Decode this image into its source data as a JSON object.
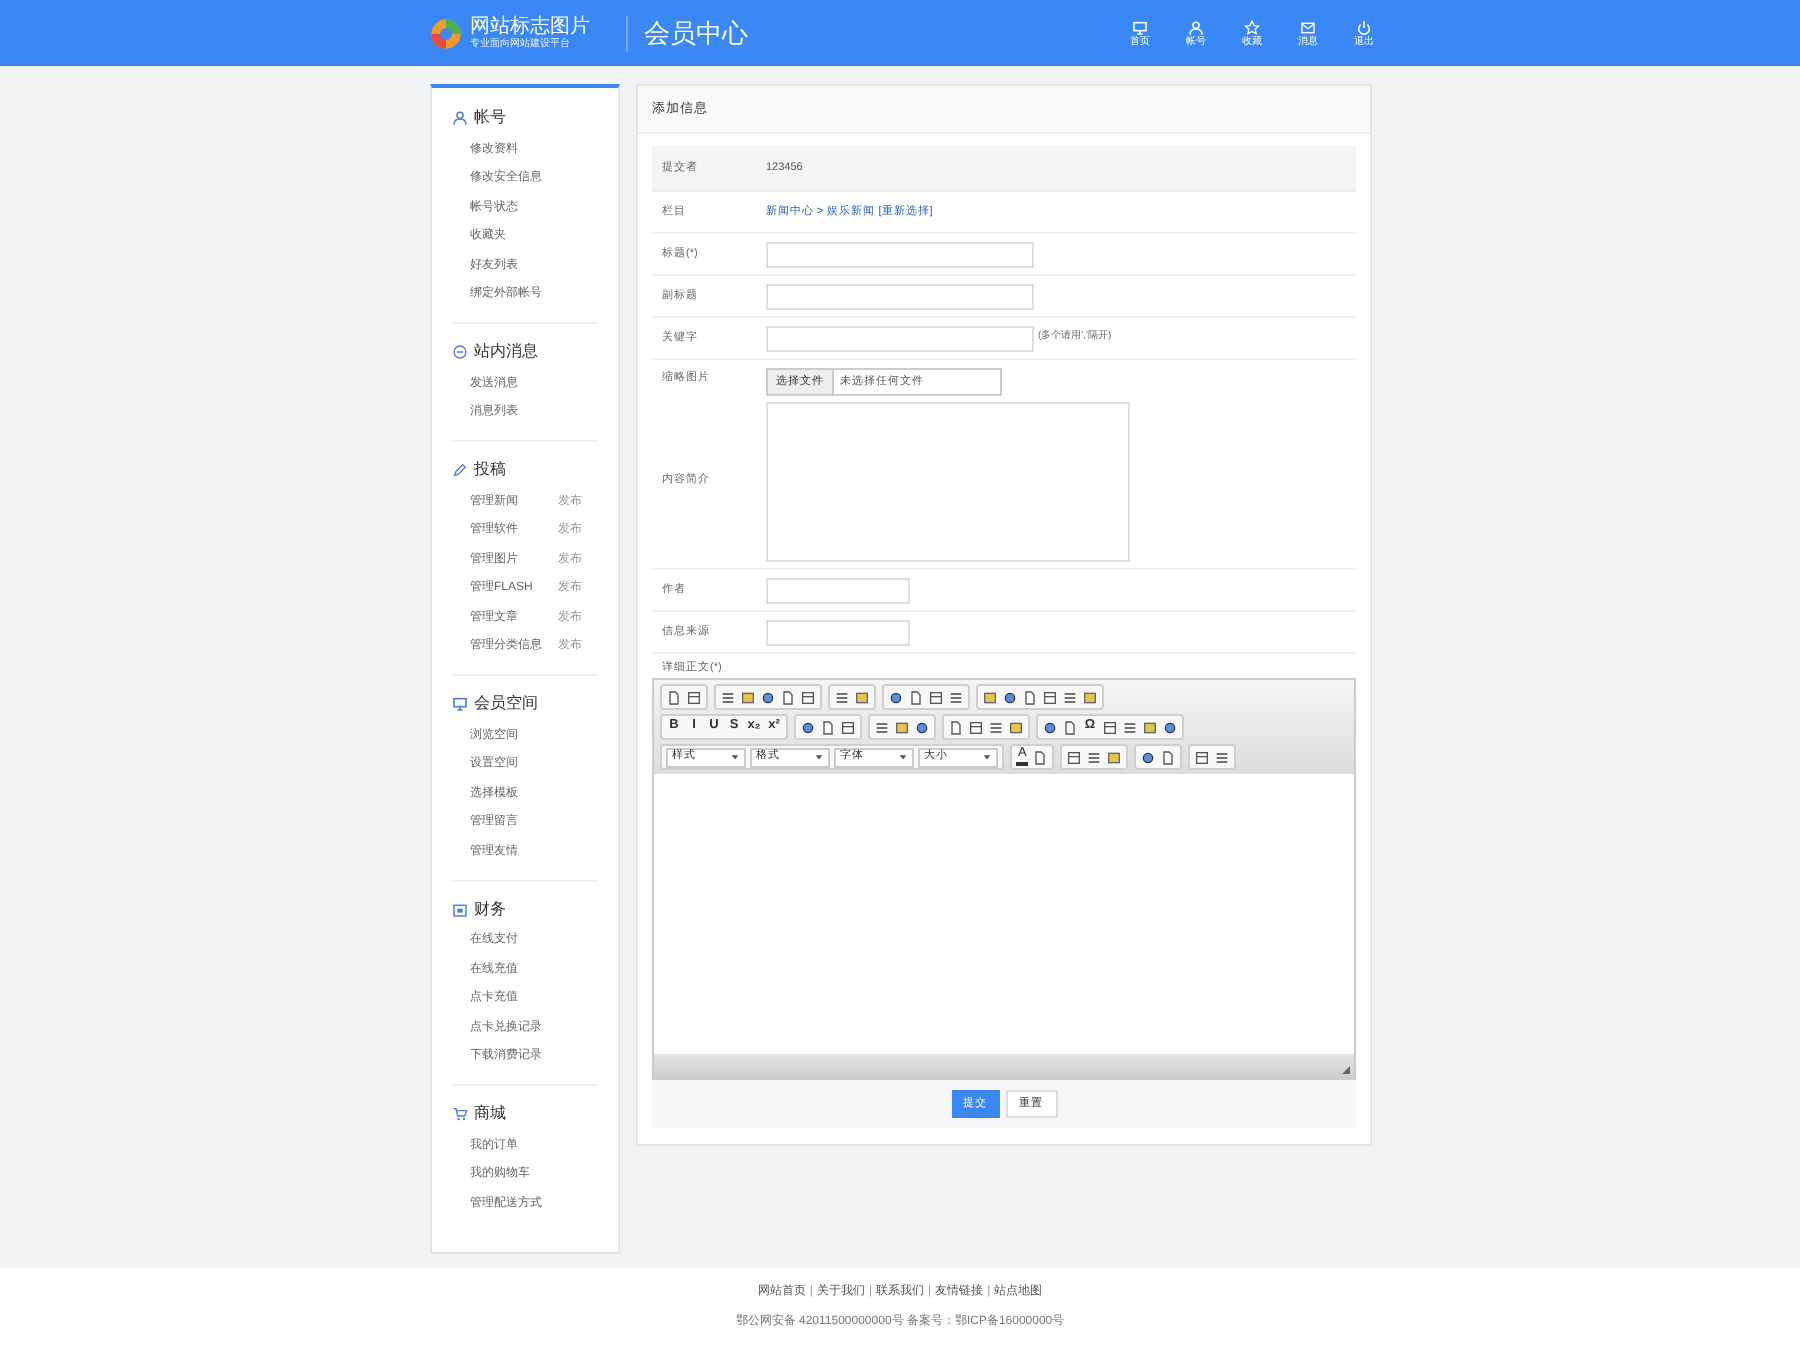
{
  "header": {
    "logo_text": "网站标志图片",
    "logo_subtitle": "专业面向网站建设平台",
    "title": "会员中心",
    "nav": [
      {
        "label": "首页"
      },
      {
        "label": "帐号"
      },
      {
        "label": "收藏"
      },
      {
        "label": "消息"
      },
      {
        "label": "退出"
      }
    ]
  },
  "sidebar": [
    {
      "title": "帐号",
      "items": [
        {
          "label": "修改资料"
        },
        {
          "label": "修改安全信息"
        },
        {
          "label": "帐号状态"
        },
        {
          "label": "收藏夹"
        },
        {
          "label": "好友列表"
        },
        {
          "label": "绑定外部帐号"
        }
      ]
    },
    {
      "title": "站内消息",
      "items": [
        {
          "label": "发送消息"
        },
        {
          "label": "消息列表"
        }
      ]
    },
    {
      "title": "投稿",
      "items": [
        {
          "label": "管理新闻",
          "action": "发布"
        },
        {
          "label": "管理软件",
          "action": "发布"
        },
        {
          "label": "管理图片",
          "action": "发布"
        },
        {
          "label": "管理FLASH",
          "action": "发布"
        },
        {
          "label": "管理文章",
          "action": "发布"
        },
        {
          "label": "管理分类信息",
          "action": "发布"
        }
      ]
    },
    {
      "title": "会员空间",
      "items": [
        {
          "label": "浏览空间"
        },
        {
          "label": "设置空间"
        },
        {
          "label": "选择模板"
        },
        {
          "label": "管理留言"
        },
        {
          "label": "管理友情"
        }
      ]
    },
    {
      "title": "财务",
      "items": [
        {
          "label": "在线支付"
        },
        {
          "label": "在线充值"
        },
        {
          "label": "点卡充值"
        },
        {
          "label": "点卡兑换记录"
        },
        {
          "label": "下载消费记录"
        }
      ]
    },
    {
      "title": "商城",
      "items": [
        {
          "label": "我的订单"
        },
        {
          "label": "我的购物车"
        },
        {
          "label": "管理配送方式"
        }
      ]
    }
  ],
  "panel": {
    "title": "添加信息",
    "rows": [
      {
        "kind": "text",
        "label": "提交者",
        "value": "123456"
      },
      {
        "kind": "path",
        "label": "栏目",
        "value": "新闻中心 > 娱乐新闻",
        "link": "[重新选择]"
      },
      {
        "kind": "input",
        "label": "标题(*)"
      },
      {
        "kind": "input",
        "label": "副标题"
      },
      {
        "kind": "input",
        "label": "关键字",
        "hint": "(多个请用','隔开)"
      },
      {
        "kind": "file",
        "label": "缩略图片",
        "button": "选择文件",
        "value": "未选择任何文件"
      },
      {
        "kind": "textarea",
        "label": "内容简介"
      },
      {
        "kind": "short",
        "label": "作者"
      },
      {
        "kind": "short",
        "label": "信息来源"
      }
    ],
    "editor": {
      "label": "详细正文(*)",
      "rows": [
        [
          [
            {
              "kind": "icon"
            },
            {
              "kind": "icon"
            }
          ],
          [
            {
              "kind": "icon"
            },
            {
              "kind": "icon"
            },
            {
              "kind": "icon"
            },
            {
              "kind": "icon"
            },
            {
              "kind": "icon"
            }
          ],
          [
            {
              "kind": "icon"
            },
            {
              "kind": "icon"
            }
          ],
          [
            {
              "kind": "icon"
            },
            {
              "kind": "icon"
            },
            {
              "kind": "icon"
            },
            {
              "kind": "icon"
            }
          ],
          [
            {
              "kind": "icon"
            },
            {
              "kind": "icon"
            },
            {
              "kind": "icon"
            },
            {
              "kind": "icon"
            },
            {
              "kind": "icon"
            },
            {
              "kind": "icon"
            }
          ]
        ],
        [
          [
            {
              "kind": "glyph",
              "text": "B"
            },
            {
              "kind": "glyph",
              "text": "I"
            },
            {
              "kind": "glyph",
              "text": "U"
            },
            {
              "kind": "glyph",
              "text": "S"
            },
            {
              "kind": "glyph",
              "text": "x₂"
            },
            {
              "kind": "glyph",
              "text": "x²"
            }
          ],
          [
            {
              "kind": "icon"
            },
            {
              "kind": "icon"
            },
            {
              "kind": "icon"
            }
          ],
          [
            {
              "kind": "icon"
            },
            {
              "kind": "icon"
            },
            {
              "kind": "icon"
            }
          ],
          [
            {
              "kind": "icon"
            },
            {
              "kind": "icon"
            },
            {
              "kind": "icon"
            },
            {
              "kind": "icon"
            }
          ],
          [
            {
              "kind": "icon"
            },
            {
              "kind": "icon"
            },
            {
              "kind": "glyph",
              "text": "Ω"
            },
            {
              "kind": "icon"
            },
            {
              "kind": "icon"
            },
            {
              "kind": "icon"
            },
            {
              "kind": "icon"
            }
          ]
        ],
        [
          [
            {
              "kind": "select",
              "text": "样式"
            },
            {
              "kind": "select",
              "text": "格式"
            },
            {
              "kind": "select",
              "text": "字体"
            },
            {
              "kind": "select",
              "text": "大小"
            }
          ],
          [
            {
              "kind": "color",
              "text": "A"
            },
            {
              "kind": "icon"
            }
          ],
          [
            {
              "kind": "icon"
            },
            {
              "kind": "icon"
            },
            {
              "kind": "icon"
            }
          ],
          [
            {
              "kind": "icon"
            },
            {
              "kind": "icon"
            }
          ],
          [
            {
              "kind": "icon"
            },
            {
              "kind": "icon"
            }
          ]
        ]
      ]
    },
    "buttons": [
      {
        "label": "提交",
        "primary": true
      },
      {
        "label": "重置",
        "primary": false
      }
    ]
  },
  "footer": {
    "separator": "|",
    "links": [
      "网站首页",
      "关于我们",
      "联系我们",
      "友情链接",
      "站点地图"
    ],
    "record": "鄂公网安备 42011500000000号 备案号：鄂ICP备16000000号"
  }
}
